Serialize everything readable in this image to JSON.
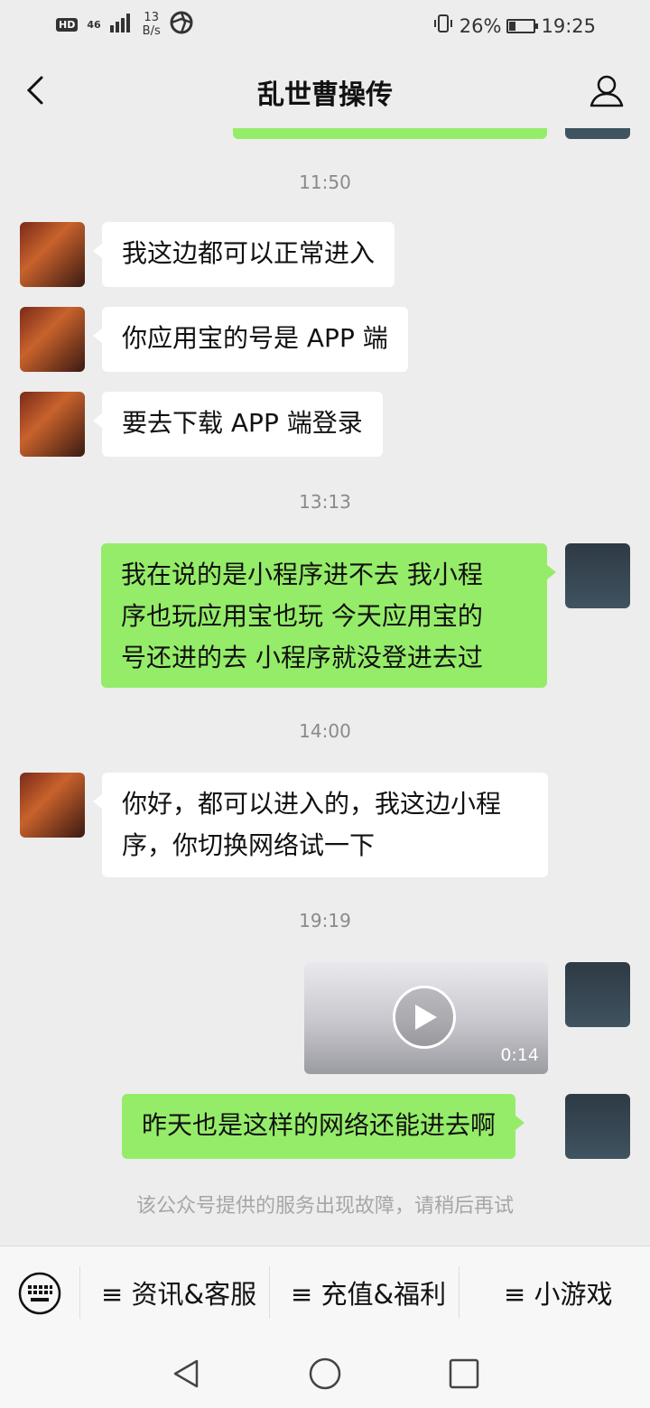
{
  "status_bar": {
    "hd": "HD",
    "network": "46",
    "speed_value": "13",
    "speed_unit": "B/s",
    "battery_pct": "26%",
    "battery_level": 0.26,
    "time": "19:25"
  },
  "header": {
    "title": "乱世曹操传"
  },
  "chat": {
    "times": [
      "11:50",
      "13:13",
      "14:00",
      "19:19"
    ],
    "messages": [
      {
        "side": "left",
        "text": "我这边都可以正常进入"
      },
      {
        "side": "left",
        "text": "你应用宝的号是 APP 端"
      },
      {
        "side": "left",
        "text": "要去下载 APP 端登录"
      },
      {
        "side": "right",
        "line1": "我在说的是小程序进不去   我小程",
        "line2": "序也玩应用宝也玩   今天应用宝的",
        "line3": "号还进的去   小程序就没登进去过"
      },
      {
        "side": "left",
        "line1": "你好，都可以进入的，我这边小程",
        "line2": "序，你切换网络试一下"
      },
      {
        "side": "right",
        "type": "video",
        "duration": "0:14"
      },
      {
        "side": "right",
        "text": "昨天也是这样的网络还能进去啊"
      }
    ],
    "system_notice": "该公众号提供的服务出现故障，请稍后再试"
  },
  "menu": {
    "items": [
      "≡ 资讯&客服",
      "≡ 充值&福利",
      "≡ 小游戏"
    ]
  },
  "icons": {
    "back": "chevron-left-icon",
    "profile": "person-icon",
    "keyboard": "keyboard-icon",
    "play": "play-icon",
    "nav_back": "triangle-back-icon",
    "nav_home": "circle-home-icon",
    "nav_recent": "square-recent-icon"
  },
  "colors": {
    "background": "#ededed",
    "bubble_self": "#95ec69",
    "bubble_other": "#ffffff"
  }
}
